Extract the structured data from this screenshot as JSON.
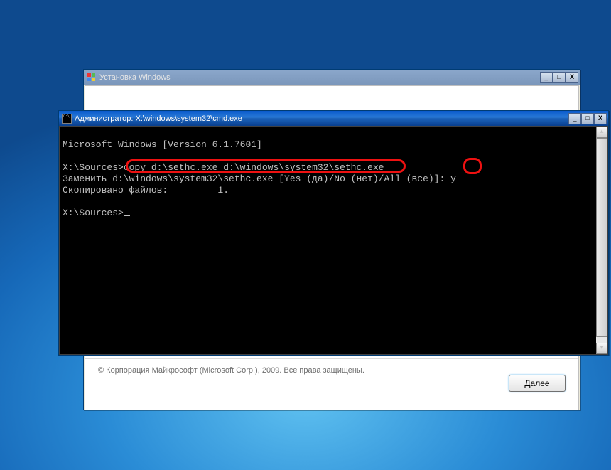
{
  "installer": {
    "title": "Установка Windows",
    "copyright": "© Корпорация Майкрософт (Microsoft Corp.), 2009. Все права защищены.",
    "next_label": "Далее"
  },
  "cmd": {
    "title": "Администратор: X:\\windows\\system32\\cmd.exe",
    "lines": {
      "banner": "Microsoft Windows [Version 6.1.7601]",
      "prompt1": "X:\\Sources>",
      "command1": "copy d:\\sethc.exe d:\\windows\\system32\\sethc.exe",
      "replace_q_pre": "Заменить d:\\windows\\system32\\sethc.exe [Yes (да)/No (нет)/All (все)]: ",
      "replace_a": "y",
      "copied": "Скопировано файлов:         1.",
      "prompt2": "X:\\Sources>"
    }
  },
  "buttons": {
    "min": "_",
    "max": "□",
    "close": "X",
    "up": "▲",
    "down": "▼"
  }
}
